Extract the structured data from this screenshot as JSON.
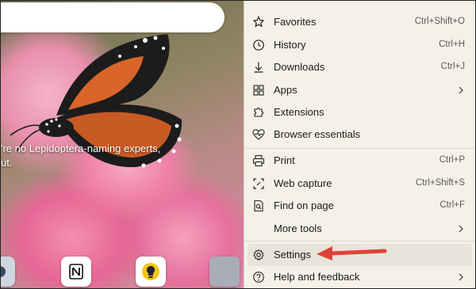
{
  "background": {
    "caption": "'re no Lepidoptera-naming experts,\nut."
  },
  "menu": {
    "items": [
      {
        "label": "Favorites",
        "shortcut": "Ctrl+Shift+O",
        "icon": "favorites-star-icon"
      },
      {
        "label": "History",
        "shortcut": "Ctrl+H",
        "icon": "history-clock-icon"
      },
      {
        "label": "Downloads",
        "shortcut": "Ctrl+J",
        "icon": "download-icon"
      },
      {
        "label": "Apps",
        "shortcut": "",
        "icon": "apps-grid-icon",
        "submenu": true
      },
      {
        "label": "Extensions",
        "shortcut": "",
        "icon": "puzzle-icon"
      },
      {
        "label": "Browser essentials",
        "shortcut": "",
        "icon": "heart-pulse-icon"
      },
      {
        "label": "Print",
        "shortcut": "Ctrl+P",
        "icon": "printer-icon"
      },
      {
        "label": "Web capture",
        "shortcut": "Ctrl+Shift+S",
        "icon": "web-capture-icon"
      },
      {
        "label": "Find on page",
        "shortcut": "Ctrl+F",
        "icon": "find-page-icon"
      },
      {
        "label": "More tools",
        "shortcut": "",
        "icon": "",
        "submenu": true
      },
      {
        "label": "Settings",
        "shortcut": "",
        "icon": "gear-icon"
      },
      {
        "label": "Help and feedback",
        "shortcut": "",
        "icon": "help-icon",
        "submenu": true
      }
    ]
  },
  "annotation": {
    "color": "#e0413b"
  },
  "colors": {
    "menu_bg": "#f4f1e8",
    "selected_bg": "#e7e4da"
  }
}
